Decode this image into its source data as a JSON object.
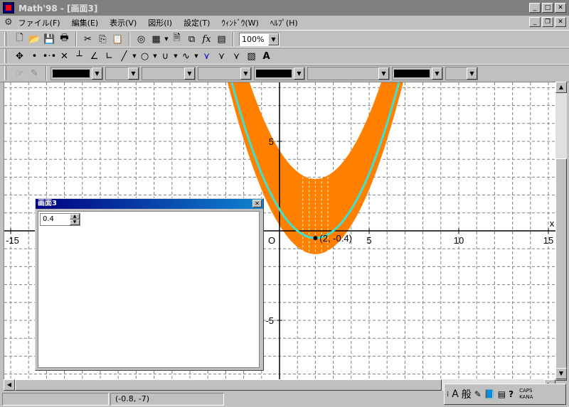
{
  "window": {
    "title": "Math'98 - [画面3]"
  },
  "caption_buttons": {
    "minimize": "_",
    "maximize": "□",
    "close": "✕"
  },
  "mdi_buttons": {
    "minimize": "_",
    "restore": "❐",
    "close": "✕"
  },
  "menu": {
    "items": [
      "ファイル(F)",
      "編集(E)",
      "表示(V)",
      "図形(I)",
      "設定(T)",
      "ｳｨﾝﾄﾞｳ(W)",
      "ﾍﾙﾌﾟ(H)"
    ]
  },
  "toolbar": {
    "zoom_value": "100%"
  },
  "graph": {
    "x_ticks": [
      "-15",
      "O",
      "5",
      "10",
      "15"
    ],
    "y_ticks": [
      "5",
      "-5"
    ],
    "x_axis_label": "x",
    "point_label": "(2, -0.4)",
    "curve_color": "#40e0d0",
    "band_color": "#ff8000",
    "axis_color": "#000000",
    "grid_color": "#808080"
  },
  "child_window": {
    "title": "画面3",
    "close": "✕",
    "spin_value": "0.4"
  },
  "statusbar": {
    "coords": "(-0.8, -7)"
  },
  "ime": {
    "mode": "A",
    "kanji": "般",
    "caps": "CAPS",
    "kana": "KANA"
  }
}
